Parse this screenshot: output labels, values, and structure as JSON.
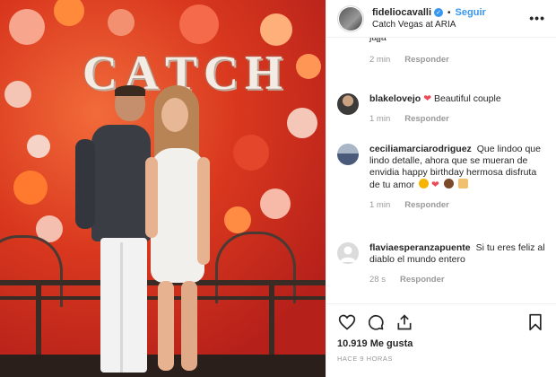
{
  "header": {
    "username": "fideliocavalli",
    "verified_icon": "verified-badge-icon",
    "separator": "•",
    "follow_label": "Seguir",
    "location": "Catch Vegas at ARIA",
    "more_label": "•••"
  },
  "photo": {
    "sign_letters": [
      "C",
      "A",
      "T",
      "C",
      "H"
    ]
  },
  "comments": [
    {
      "username": "",
      "text": "jajja",
      "age": "2 min",
      "reply": "Responder"
    },
    {
      "username": "blakelovejo",
      "text": "Beautiful couple",
      "age": "1 min",
      "reply": "Responder"
    },
    {
      "username": "ceciliamarciarodriguez",
      "text": "Que lindoo que lindo detalle, ahora que se mueran de envidia happy birthday hermosa disfruta de tu amor",
      "age": "1 min",
      "reply": "Responder"
    },
    {
      "username": "flaviaesperanzapuente",
      "text": "Si tu eres feliz al diablo el mundo entero",
      "age": "28 s",
      "reply": "Responder"
    }
  ],
  "actions": {
    "likes": "10.919 Me gusta",
    "posted": "HACE 9 HORAS"
  },
  "colors": {
    "link_blue": "#3897f0",
    "heart_red": "#ed4956",
    "muted_gray": "#999999"
  }
}
